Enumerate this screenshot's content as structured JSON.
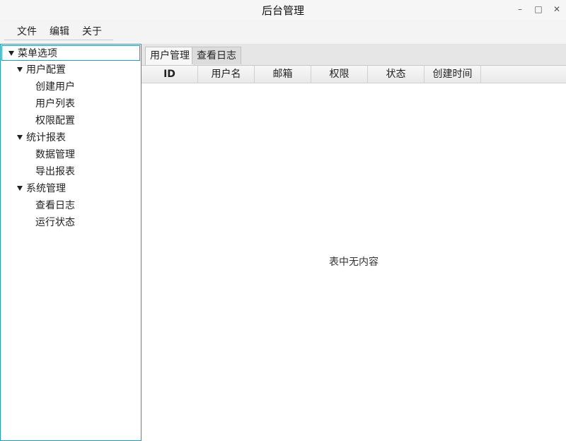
{
  "window": {
    "title": "后台管理",
    "minimize_glyph": "–",
    "maximize_glyph": "□",
    "close_glyph": "✕"
  },
  "menubar": {
    "file": "文件",
    "edit": "编辑",
    "about": "关于"
  },
  "tree": {
    "root": "菜单选项",
    "groups": [
      {
        "label": "用户配置",
        "items": [
          "创建用户",
          "用户列表",
          "权限配置"
        ]
      },
      {
        "label": "统计报表",
        "items": [
          "数据管理",
          "导出报表"
        ]
      },
      {
        "label": "系统管理",
        "items": [
          "查看日志",
          "运行状态"
        ]
      }
    ]
  },
  "tabs": [
    "用户管理",
    "查看日志"
  ],
  "table": {
    "columns": [
      "ID",
      "用户名",
      "邮箱",
      "权限",
      "状态",
      "创建时间"
    ],
    "empty_text": "表中无内容"
  }
}
